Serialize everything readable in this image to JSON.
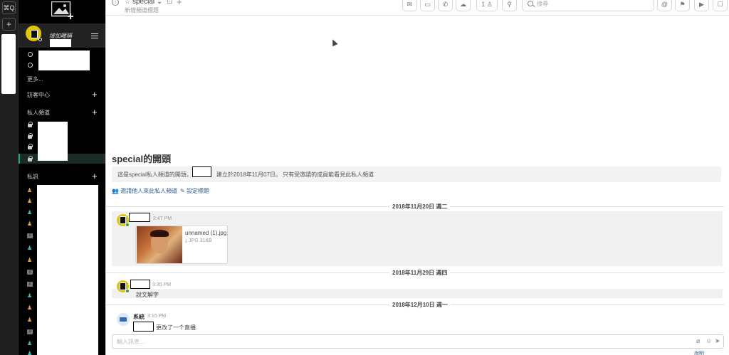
{
  "rail": {
    "search_label": "⌘Q",
    "add_label": "+"
  },
  "sidebar": {
    "status_text": "增加暱稱",
    "more_label": "更多...",
    "visitor_center": "訪客中心",
    "private_channels": "私人頻道",
    "direct_messages": "私訊"
  },
  "header": {
    "channel_name": "special",
    "add_header": "新增頻道標題",
    "pinned_count": "1",
    "search_placeholder": "搜尋"
  },
  "intro": {
    "title": "special的開頭",
    "text_prefix": "這是special私人頻道的開頭，由",
    "text_suffix": "建立於2018年11月07日。 只有受邀請的成員能看見此私人頻道",
    "invite_link": "邀請他人來此私人頻道",
    "set_header_link": "設定標題"
  },
  "dates": [
    "2018年11月20日 週二",
    "2018年11月29日 週四",
    "2018年12月10日 週一"
  ],
  "posts": [
    {
      "time": "2:47 PM",
      "file_name": "unnamed (1).jpg",
      "file_meta": "JPG 31KB"
    },
    {
      "time": "3:35 PM",
      "text": "說文解字"
    },
    {
      "author": "系統",
      "time": "3:15 PM",
      "text": "更改了一个直播."
    }
  ],
  "composer": {
    "placeholder": "輸入訊息...",
    "help": "說明"
  },
  "icons": [
    "image-add-icon",
    "menu-icon",
    "globe-icon",
    "lock-icon",
    "person-icon",
    "mail-icon",
    "video-icon",
    "phone-icon",
    "cloud-icon",
    "user-icon",
    "pin-icon",
    "search-icon",
    "at-icon",
    "flag-icon",
    "play-icon",
    "chat-icon",
    "paperclip-icon",
    "emoji-icon",
    "send-icon"
  ]
}
